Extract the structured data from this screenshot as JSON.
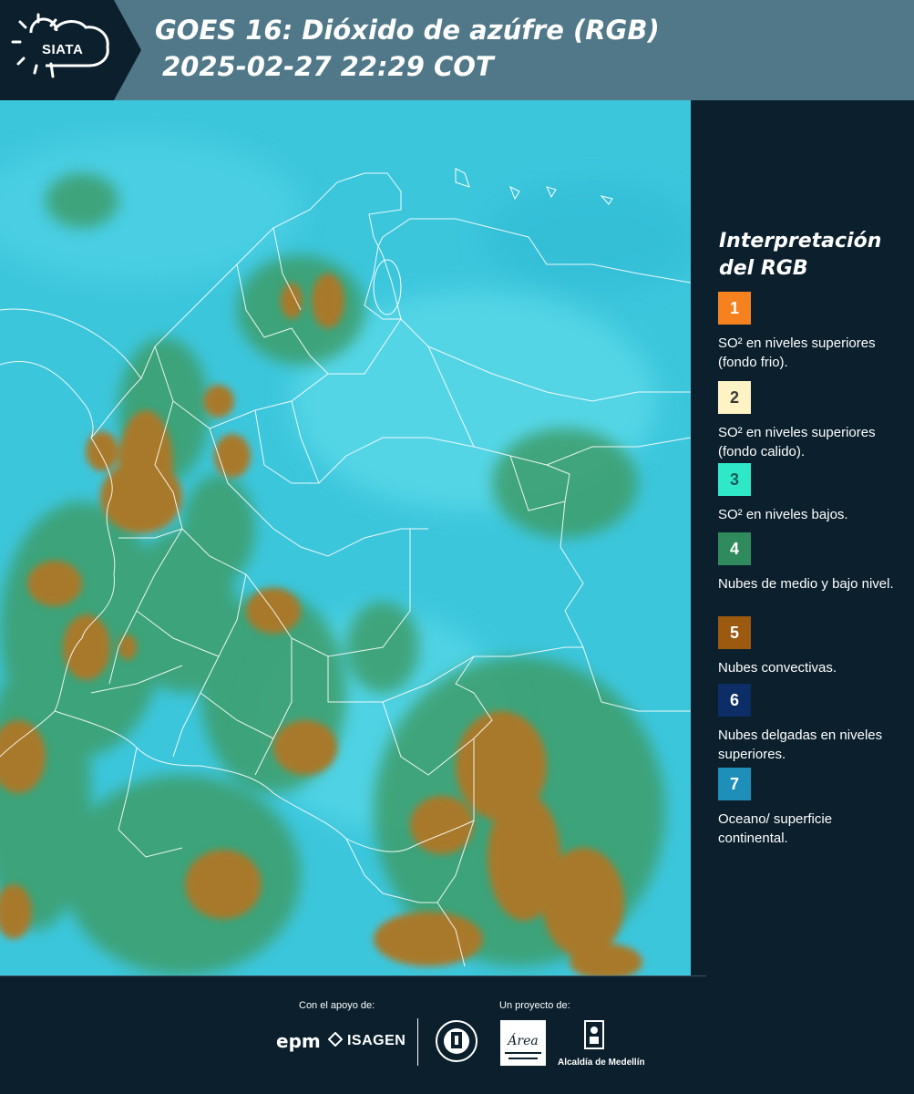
{
  "header": {
    "logo_text": "SIATA",
    "title_line1": "GOES 16: Dióxido de azúfre (RGB)",
    "title_line2": "2025-02-27 22:29 COT"
  },
  "legend": {
    "title": "Interpretación del RGB",
    "items": [
      {
        "number": "1",
        "color": "#f5821f",
        "text_color": "#ffffff",
        "label": "SO² en niveles superiores (fondo frio)."
      },
      {
        "number": "2",
        "color": "#fdf3c4",
        "text_color": "#3a3a3a",
        "label": "SO² en niveles superiores (fondo calido)."
      },
      {
        "number": "3",
        "color": "#2ee8c8",
        "text_color": "#1d5b5a",
        "label": "SO² en niveles bajos."
      },
      {
        "number": "4",
        "color": "#2f8a5e",
        "text_color": "#ffffff",
        "label": "Nubes de medio y bajo nivel."
      },
      {
        "number": "5",
        "color": "#9b5a10",
        "text_color": "#ffffff",
        "label": "Nubes convectivas."
      },
      {
        "number": "6",
        "color": "#0c2d66",
        "text_color": "#ffffff",
        "label": "Nubes delgadas en niveles superiores."
      },
      {
        "number": "7",
        "color": "#1d8fb8",
        "text_color": "#ffffff",
        "label": "Oceano/ superficie continental."
      }
    ]
  },
  "footer": {
    "support_label": "Con el apoyo de:",
    "project_label": "Un proyecto de:",
    "sponsor_epm": "epm",
    "sponsor_isagen": "ISAGEN",
    "partner_area": "Área",
    "partner_alcaldia": "Alcaldía de Medellín"
  }
}
